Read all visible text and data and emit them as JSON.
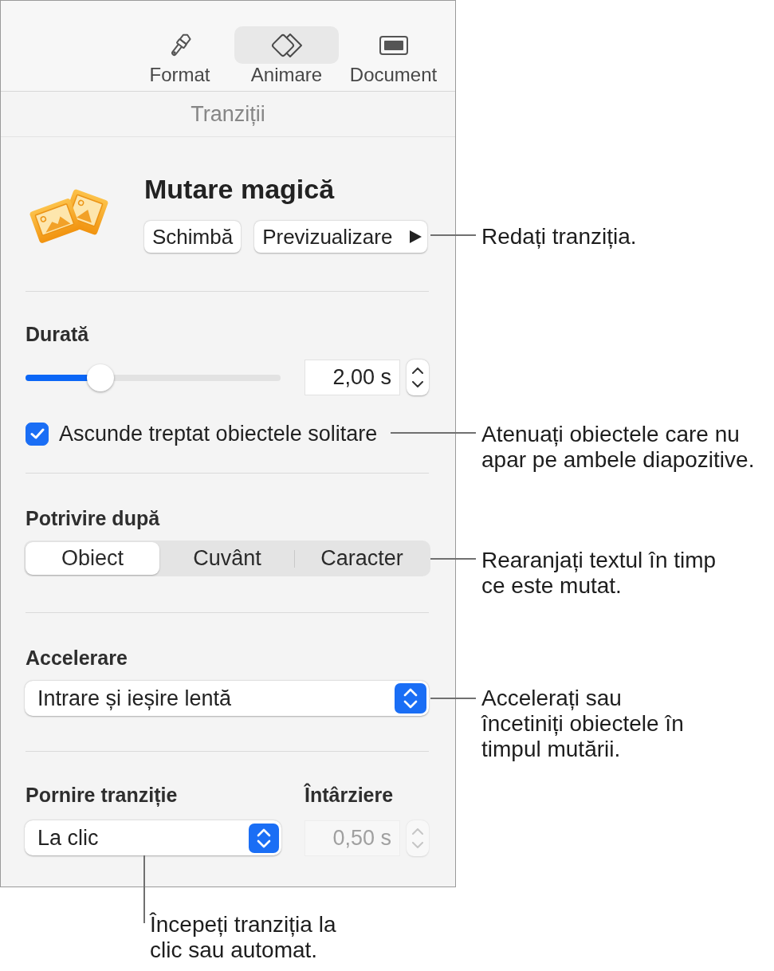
{
  "toolbar": {
    "tabs": [
      {
        "label": "Format",
        "selected": false
      },
      {
        "label": "Animare",
        "selected": true
      },
      {
        "label": "Document",
        "selected": false
      }
    ]
  },
  "section_title": "Tranziții",
  "transition": {
    "name": "Mutare magică",
    "buttons": [
      {
        "label": "Schimbă",
        "kind": "plain"
      },
      {
        "label": "Previzualizare",
        "kind": "play"
      }
    ]
  },
  "duration": {
    "label": "Durată",
    "level": 0.27,
    "value": "2,00 s"
  },
  "fade_option": {
    "label": "Ascunde treptat obiectele solitare",
    "checked": true
  },
  "match": {
    "label": "Potrivire după",
    "segments": [
      {
        "label": "Obiect",
        "selected": true
      },
      {
        "label": "Cuvânt",
        "selected": false
      },
      {
        "label": "Caracter",
        "selected": false
      }
    ]
  },
  "acceleration": {
    "label": "Accelerare",
    "value": "Intrare și ieșire lentă"
  },
  "start": {
    "label": "Pornire tranziție",
    "value": "La clic"
  },
  "delay": {
    "label": "Întârziere",
    "value": "0,50 s",
    "disabled": true
  },
  "callouts": [
    {
      "kind": "side",
      "text": "Redați tranziția."
    },
    {
      "kind": "side",
      "text": "Atenuați obiectele care nu\napar pe ambele diapozitive."
    },
    {
      "kind": "side",
      "text": "Rearanjați textul în timp\nce este mutat."
    },
    {
      "kind": "side",
      "text": "Accelerați sau\nîncetiniți obiectele în\ntimpul mutării."
    },
    {
      "kind": "below",
      "text": "Începeți tranziția la\nclic sau automat."
    }
  ]
}
